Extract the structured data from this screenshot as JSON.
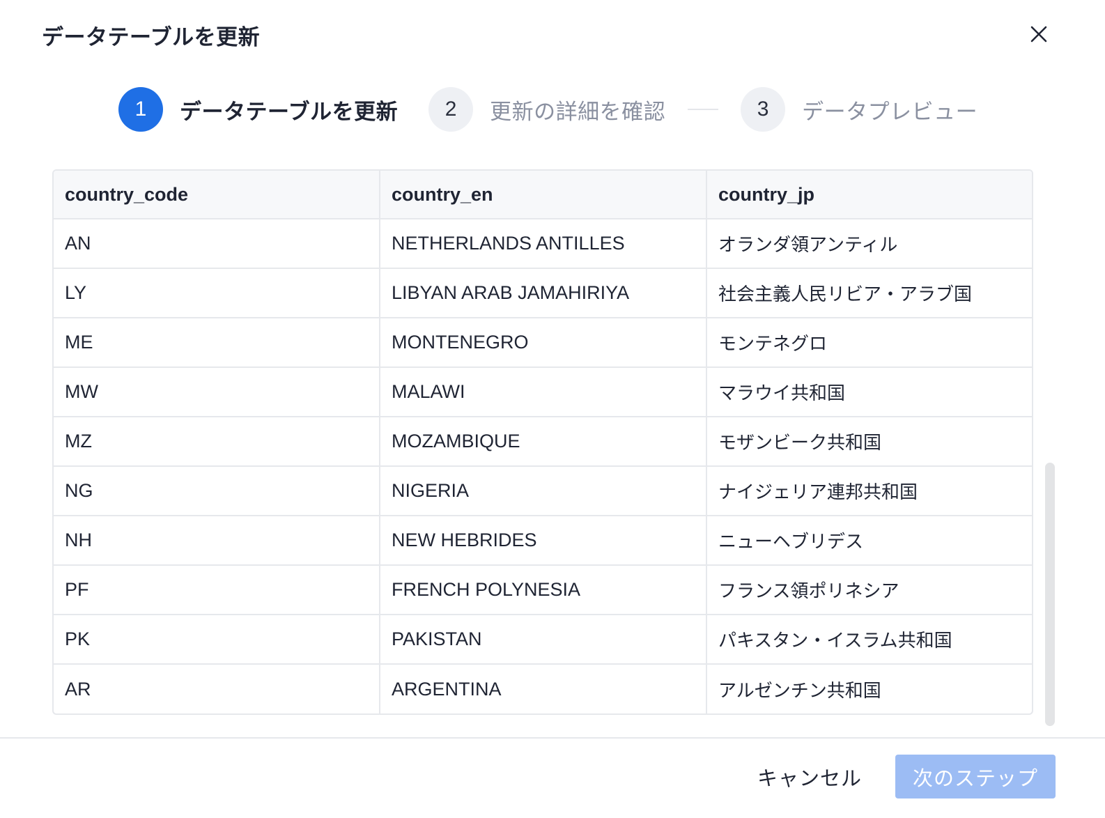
{
  "dialog": {
    "title": "データテーブルを更新",
    "close_icon": "close-icon"
  },
  "stepper": {
    "steps": [
      {
        "number": "1",
        "label": "データテーブルを更新",
        "state": "active"
      },
      {
        "number": "2",
        "label": "更新の詳細を確認",
        "state": "inactive"
      },
      {
        "number": "3",
        "label": "データプレビュー",
        "state": "inactive"
      }
    ],
    "active_color": "#1f6fe5"
  },
  "table": {
    "columns": [
      "country_code",
      "country_en",
      "country_jp"
    ],
    "rows": [
      [
        "AN",
        "NETHERLANDS ANTILLES",
        "オランダ領アンティル"
      ],
      [
        "LY",
        "LIBYAN ARAB JAMAHIRIYA",
        "社会主義人民リビア・アラブ国"
      ],
      [
        "ME",
        "MONTENEGRO",
        "モンテネグロ"
      ],
      [
        "MW",
        "MALAWI",
        "マラウイ共和国"
      ],
      [
        "MZ",
        "MOZAMBIQUE",
        "モザンビーク共和国"
      ],
      [
        "NG",
        "NIGERIA",
        "ナイジェリア連邦共和国"
      ],
      [
        "NH",
        "NEW HEBRIDES",
        "ニューヘブリデス"
      ],
      [
        "PF",
        "FRENCH POLYNESIA",
        "フランス領ポリネシア"
      ],
      [
        "PK",
        "PAKISTAN",
        "パキスタン・イスラム共和国"
      ],
      [
        "AR",
        "ARGENTINA",
        "アルゼンチン共和国"
      ]
    ]
  },
  "footer": {
    "cancel_label": "キャンセル",
    "next_label": "次のステップ",
    "next_color": "#9cbcf4"
  }
}
